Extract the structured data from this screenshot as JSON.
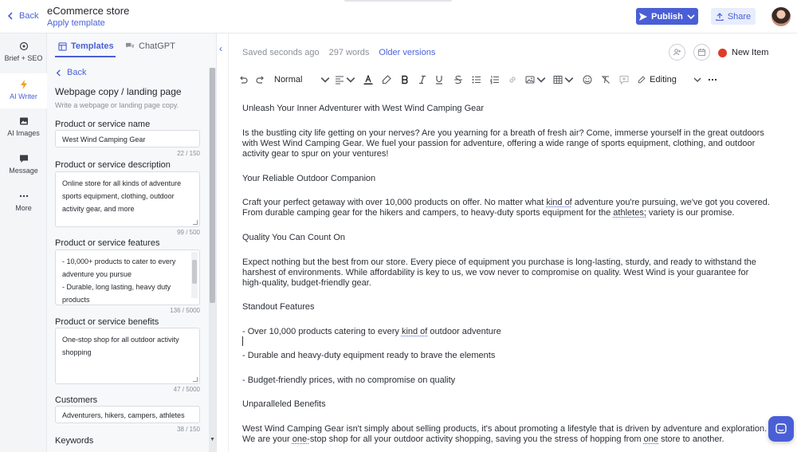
{
  "topbar": {
    "back_label": "Back",
    "title": "eCommerce store",
    "apply_template": "Apply template",
    "publish_label": "Publish",
    "share_label": "Share"
  },
  "rail": {
    "items": [
      {
        "label": "Brief + SEO",
        "icon": "target-icon"
      },
      {
        "label": "AI Writer",
        "icon": "bolt-icon",
        "active": true
      },
      {
        "label": "AI Images",
        "icon": "image-icon"
      },
      {
        "label": "Message",
        "icon": "chat-icon"
      },
      {
        "label": "More",
        "icon": "more-icon"
      }
    ]
  },
  "panel": {
    "tabs": [
      {
        "label": "Templates",
        "active": true
      },
      {
        "label": "ChatGPT",
        "active": false
      }
    ],
    "back_label": "Back",
    "heading": "Webpage copy / landing page",
    "subheading": "Write a webpage or landing page copy.",
    "fields": [
      {
        "label": "Product or service name",
        "value": "West Wind Camping Gear",
        "counter": "22 / 150"
      },
      {
        "label": "Product or service description",
        "value": "Online store for all kinds of adventure sports equipment, clothing, outdoor activity gear, and more",
        "counter": "99 / 500"
      },
      {
        "label": "Product or service features",
        "value_lines": [
          "- 10,000+ products to cater to every adventure you pursue",
          "- Durable, long lasting, heavy duty products"
        ],
        "counter": "136 / 5000"
      },
      {
        "label": "Product or service benefits",
        "value": "One-stop shop for all outdoor activity shopping",
        "counter": "47 / 5000"
      },
      {
        "label": "Customers",
        "value": "Adventurers, hikers, campers, athletes",
        "counter": "38 / 150"
      },
      {
        "label": "Keywords",
        "value": "",
        "counter": ""
      }
    ]
  },
  "editor": {
    "saved_status": "Saved seconds ago",
    "word_count": "297 words",
    "older_versions": "Older versions",
    "new_item_label": "New Item",
    "status_color": "#e03a28",
    "toolbar": {
      "paragraph_style": "Normal",
      "mode": "Editing"
    },
    "paragraphs": [
      "Unleash Your Inner Adventurer with West Wind Camping Gear",
      "Is the bustling city life getting on your nerves? Are you yearning for a breath of fresh air? Come, immerse yourself in the great outdoors with West Wind Camping Gear. We fuel your passion for adventure, offering a wide range of sports equipment, clothing, and outdoor activity gear to spur on your ventures!",
      "Your Reliable Outdoor Companion",
      "Quality You Can Count On",
      "Expect nothing but the best from our store. Every piece of equipment you purchase is long-lasting, sturdy, and ready to withstand the harshest of environments. While affordability is key to us, we vow never to compromise on quality. West Wind is your guarantee for high-quality, budget-friendly gear.",
      "Standout Features",
      "- Durable and heavy-duty equipment ready to brave the elements",
      "- Budget-friendly prices, with no compromise on quality",
      "Unparalleled Benefits"
    ],
    "para_craft": {
      "a": "Craft your perfect getaway with over 10,000 products on offer. No matter what ",
      "b": "kind of",
      "c": " adventure you're pursuing, we've got you covered. From durable camping gear for the hikers and campers, to heavy-duty sports equipment for the ",
      "d": "athletes;",
      "e": " variety is our promise."
    },
    "para_feature1": {
      "a": "- Over 10,000 products catering to every ",
      "b": "kind of",
      "c": " outdoor adventure"
    },
    "para_last": {
      "a": "West Wind Camping Gear isn't simply about selling products, it's about promoting a lifestyle that is driven by adventure and exploration. We are your ",
      "b": "one-",
      "c": "stop shop for all your outdoor activity shopping, saving you the stress of hopping from ",
      "d": "one",
      "e": " store to another."
    }
  }
}
